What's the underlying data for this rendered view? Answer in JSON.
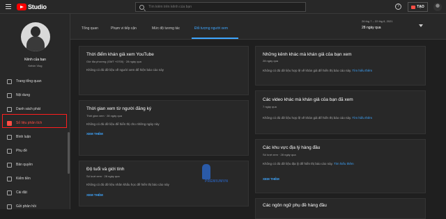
{
  "header": {
    "app_name": "Studio",
    "search_placeholder": "Tìm kiếm trên kênh của bạn",
    "help_glyph": "?",
    "create_label": "TẠO"
  },
  "channel": {
    "name": "Kênh của bạn",
    "subtitle": "Kelvin Vlog"
  },
  "sidebar": {
    "items": [
      {
        "label": "Trang tổng quan",
        "icon": "dashboard-icon"
      },
      {
        "label": "Nội dung",
        "icon": "content-icon"
      },
      {
        "label": "Danh sách phát",
        "icon": "playlist-icon"
      },
      {
        "label": "Số liệu phân tích",
        "icon": "analytics-icon",
        "active": true
      },
      {
        "label": "Bình luận",
        "icon": "comments-icon"
      },
      {
        "label": "Phụ đề",
        "icon": "subtitles-icon"
      },
      {
        "label": "Bản quyền",
        "icon": "copyright-icon"
      },
      {
        "label": "Kiếm tiền",
        "icon": "monetization-icon"
      },
      {
        "label": "Cài đặt",
        "icon": "settings-icon"
      },
      {
        "label": "Gửi phản hồi",
        "icon": "feedback-icon"
      }
    ]
  },
  "tabs": [
    {
      "label": "Tổng quan"
    },
    {
      "label": "Phạm vi tiếp cận"
    },
    {
      "label": "Mức độ tương tác"
    },
    {
      "label": "Đối tượng người xem",
      "active": true
    }
  ],
  "date_range": {
    "range": "26 thg 7 – 22 thg 8, 2021",
    "label": "28 ngày qua"
  },
  "cards_left": [
    {
      "title": "Thời điểm khán giả xem YouTube",
      "subtitle": "Giờ địa phương (GMT +0700) · 28 ngày qua",
      "body": "Không có đủ dữ liệu về người xem để hiện báo cáo này"
    },
    {
      "title": "Thời gian xem từ người đăng ký",
      "subtitle": "Thời gian xem · 28 ngày qua",
      "body": "Không có đủ dữ liệu để hiển thị cho những ngày này",
      "more": "XEM THÊM"
    },
    {
      "title": "Độ tuổi và giới tính",
      "subtitle": "Số lượt xem · 28 ngày qua",
      "body": "Không có đủ dữ liệu nhân khẩu học để hiển thị báo cáo này",
      "more": "XEM THÊM"
    }
  ],
  "cards_right": [
    {
      "title": "Những kênh khác mà khán giả của bạn xem",
      "subtitle": "28 ngày qua",
      "body": "Không có đủ dữ liệu hợp lệ về khán giả để hiển thị báo cáo này.",
      "link": "Tìm hiểu thêm"
    },
    {
      "title": "Các video khác mà khán giả của bạn đã xem",
      "subtitle": "7 ngày qua",
      "body": "Không có đủ dữ liệu hợp lệ về khán giả để hiển thị báo cáo này.",
      "link": "Tìm hiểu thêm"
    },
    {
      "title": "Các khu vực địa lý hàng đầu",
      "subtitle": "Số lượt xem · 28 ngày qua",
      "body": "Không có đủ dữ liệu địa lý để hiển thị báo cáo này.",
      "link": "Tìm hiểu thêm",
      "more": "XEM THÊM"
    },
    {
      "title": "Các ngôn ngữ phụ đề hàng đầu"
    }
  ],
  "watermark_text": "PREMIUMVN",
  "colors": {
    "accent_blue": "#3ea6ff",
    "active_red": "#ff4e45",
    "highlight_red": "#ff1e1e",
    "brand_red": "#ff0000"
  }
}
